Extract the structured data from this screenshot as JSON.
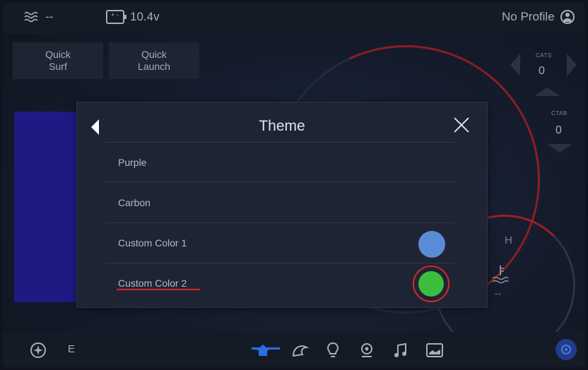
{
  "topbar": {
    "wave_value": "--",
    "battery_value": "10.4v",
    "profile_label": "No Profile"
  },
  "quick_buttons": [
    {
      "line1": "Quick",
      "line2": "Surf"
    },
    {
      "line1": "Quick",
      "line2": "Launch"
    }
  ],
  "right_panel": {
    "cats_label": "CATS",
    "cats_value": "0",
    "ctab_label": "CTAB",
    "ctab_value": "0"
  },
  "gauge": {
    "h_label": "H",
    "temp_value": "--"
  },
  "dialog": {
    "title": "Theme",
    "items": [
      {
        "label": "Purple"
      },
      {
        "label": "Carbon"
      },
      {
        "label": "Custom Color 1",
        "swatch": "#5a8bd6"
      },
      {
        "label": "Custom Color 2",
        "swatch": "#3dbd3e",
        "selected": true
      }
    ]
  },
  "bottombar": {
    "compass_label": "E",
    "nav_icons": [
      "home-icon",
      "wave-icon",
      "lightbulb-icon",
      "location-icon",
      "music-icon",
      "camera-icon"
    ],
    "active": "home-icon"
  },
  "colors": {
    "accent_red": "#d8272f",
    "active_blue": "#1f5fd0",
    "dialog_bg": "#1f2434"
  }
}
